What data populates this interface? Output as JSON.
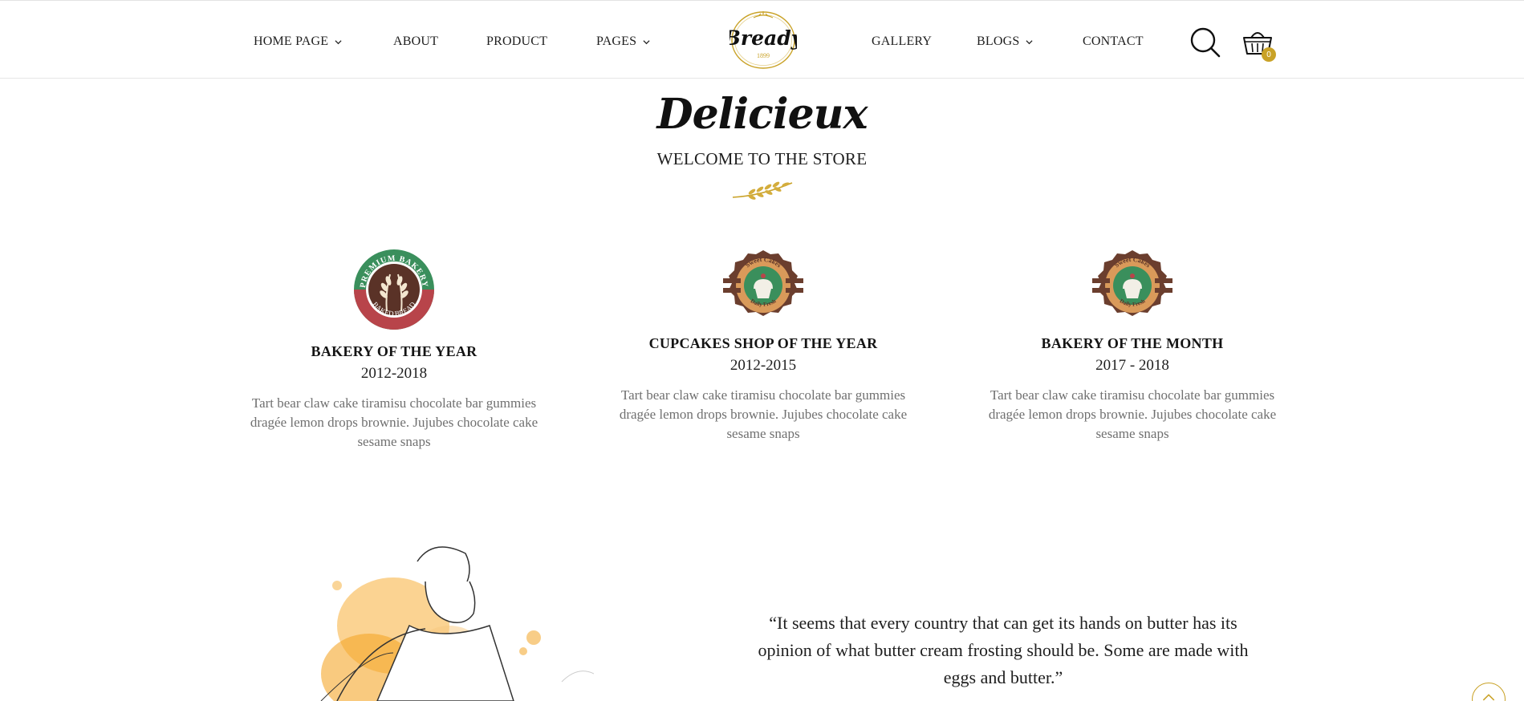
{
  "nav": {
    "left": [
      {
        "label": "HOME PAGE",
        "dropdown": true
      },
      {
        "label": "ABOUT",
        "dropdown": false
      },
      {
        "label": "PRODUCT",
        "dropdown": false
      },
      {
        "label": "PAGES",
        "dropdown": true
      }
    ],
    "right": [
      {
        "label": "GALLERY",
        "dropdown": false
      },
      {
        "label": "BLOGS",
        "dropdown": true
      },
      {
        "label": "CONTACT",
        "dropdown": false
      }
    ],
    "logo": {
      "name": "Bready",
      "year": "1899"
    },
    "cart_count": "0",
    "icons": [
      "search-icon",
      "shopping-basket-icon"
    ]
  },
  "intro": {
    "script_title": "Delicieux",
    "subtitle": "WELCOME TO THE STORE"
  },
  "awards": [
    {
      "badge": "premium-bakery-badge",
      "badge_text_top": "PREMIUM BAKERY",
      "badge_text_bottom": "BAKED BREAD",
      "title": "BAKERY OF THE YEAR",
      "years": "2012-2018",
      "text": "Tart bear claw cake tiramisu chocolate bar gummies dragée lemon drops brownie. Jujubes chocolate cake sesame snaps"
    },
    {
      "badge": "sweet-cakes-badge",
      "badge_text_top": "Sweet Cakes",
      "badge_text_bottom": "Daily Fresh",
      "title": "CUPCAKES SHOP OF THE YEAR",
      "years": "2012-2015",
      "text": "Tart bear claw cake tiramisu chocolate bar gummies dragée lemon drops brownie. Jujubes chocolate cake sesame snaps"
    },
    {
      "badge": "sweet-cakes-badge",
      "badge_text_top": "Sweet Cakes",
      "badge_text_bottom": "Daily Fresh",
      "title": "BAKERY OF THE MONTH",
      "years": "2017 - 2018",
      "text": "Tart bear claw cake tiramisu chocolate bar gummies dragée lemon drops brownie. Jujubes chocolate cake sesame snaps"
    }
  ],
  "quote": {
    "text": "“It seems that every country that can get its hands on butter has its opinion of what butter cream frosting should be. Some are made with eggs and butter.”"
  },
  "colors": {
    "accent_gold": "#c9a227",
    "badge_green": "#3a8f5c",
    "badge_red": "#b8444a",
    "badge_brown": "#6b3e2e",
    "body_text": "#707070"
  }
}
